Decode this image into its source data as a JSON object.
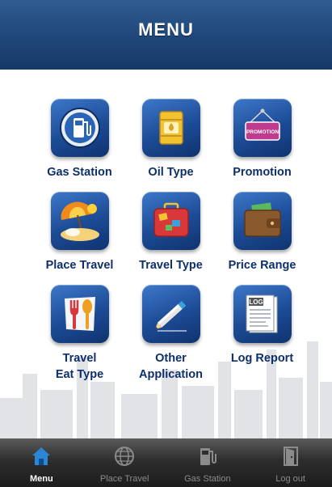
{
  "header": {
    "title": "MENU"
  },
  "menu": {
    "items": [
      {
        "label": "Gas Station",
        "icon": "gas-pump-icon"
      },
      {
        "label": "Oil Type",
        "icon": "oil-drum-icon"
      },
      {
        "label": "Promotion",
        "icon": "promotion-sign-icon",
        "sign_text": "PROMOTION"
      },
      {
        "label": "Place Travel",
        "icon": "beach-umbrella-icon"
      },
      {
        "label": "Travel Type",
        "icon": "suitcase-icon"
      },
      {
        "label": "Price Range",
        "icon": "wallet-icon"
      },
      {
        "label": "Travel\nEat Type",
        "icon": "fork-spoon-icon"
      },
      {
        "label": "Other\nApplication",
        "icon": "pencil-icon"
      },
      {
        "label": "Log Report",
        "icon": "log-document-icon",
        "doc_text": "LOG"
      }
    ]
  },
  "tabbar": {
    "tabs": [
      {
        "label": "Menu",
        "icon": "home-icon",
        "active": true
      },
      {
        "label": "Place Travel",
        "icon": "globe-icon",
        "active": false
      },
      {
        "label": "Gas Station",
        "icon": "gas-pump-icon",
        "active": false
      },
      {
        "label": "Log out",
        "icon": "logout-door-icon",
        "active": false
      }
    ]
  },
  "colors": {
    "header": "#1f4678",
    "tile": "#1c4b95",
    "label": "#0d2f6b",
    "tabbar": "#2e2e2e",
    "tab_active_icon": "#2b86d6"
  }
}
